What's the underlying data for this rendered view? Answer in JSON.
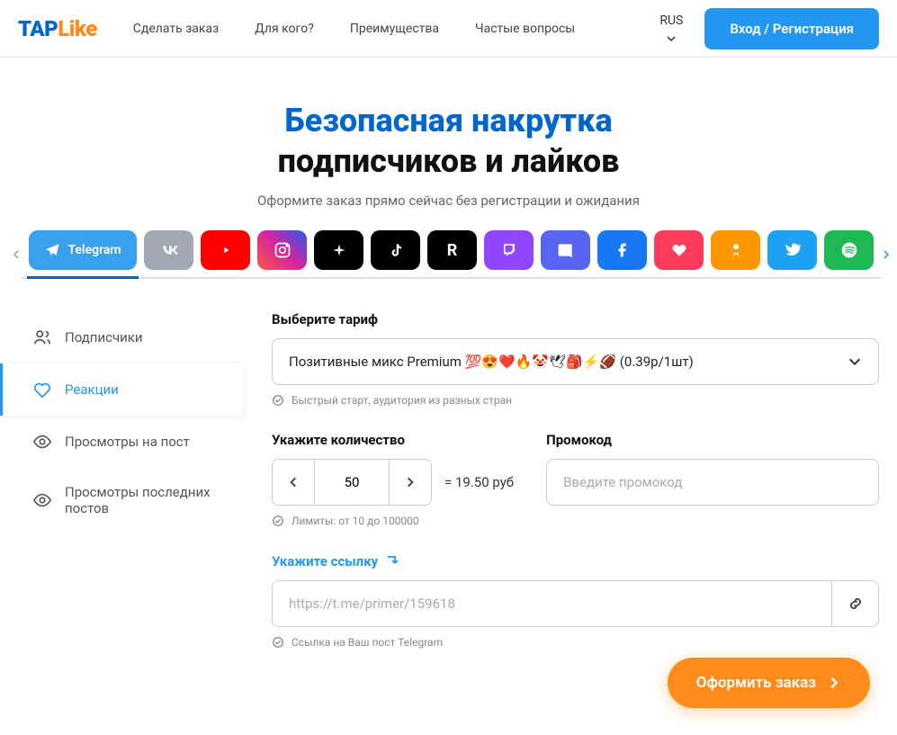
{
  "logo": {
    "part1": "TAP",
    "part2": "Like"
  },
  "nav": {
    "items": [
      "Сделать заказ",
      "Для кого?",
      "Преимущества",
      "Частые вопросы"
    ]
  },
  "lang": {
    "label": "RUS"
  },
  "login": {
    "label": "Вход / Регистрация"
  },
  "hero": {
    "line1": "Безопасная накрутка",
    "line2": "подписчиков и лайков",
    "sub": "Оформите заказ прямо сейчас без регистрации и ожидания"
  },
  "socials": {
    "active": {
      "name": "Telegram",
      "bg": "#39a0ed"
    },
    "items": [
      {
        "id": "vk",
        "bg": "#a2a9b3"
      },
      {
        "id": "youtube",
        "bg": "#ff0000"
      },
      {
        "id": "instagram",
        "bg": "linear-gradient(45deg,#fd5949,#d6249f,#285AEB)"
      },
      {
        "id": "tiktok-x",
        "bg": "#000"
      },
      {
        "id": "tiktok",
        "bg": "#000"
      },
      {
        "id": "rutube",
        "bg": "#000"
      },
      {
        "id": "twitch",
        "bg": "#9146ff"
      },
      {
        "id": "discord",
        "bg": "#5865f2"
      },
      {
        "id": "facebook",
        "bg": "#1877f2"
      },
      {
        "id": "likee",
        "bg": "#ff3b5c"
      },
      {
        "id": "ok",
        "bg": "#ff9800"
      },
      {
        "id": "twitter",
        "bg": "#1da1f2"
      },
      {
        "id": "spotify",
        "bg": "#1db954"
      }
    ]
  },
  "sidebar": {
    "items": [
      {
        "label": "Подписчики"
      },
      {
        "label": "Реакции"
      },
      {
        "label": "Просмотры на пост"
      },
      {
        "label": "Просмотры последних постов"
      }
    ]
  },
  "form": {
    "tariff_label": "Выберите тариф",
    "tariff_value": "Позитивные микс Premium 💯😍❤️🔥🤡🕊🎒⚡🏈 (0.39р/1шт)",
    "tariff_hint": "Быстрый старт, аудитория из разных стран",
    "qty_label": "Укажите количество",
    "qty_value": "50",
    "price_text": "= 19.50 руб",
    "qty_hint": "Лимиты: от 10 до 100000",
    "promo_label": "Промокод",
    "promo_placeholder": "Введите промокод",
    "link_label": "Укажите ссылку",
    "link_placeholder": "https://t.me/primer/159618",
    "link_hint": "Ссылка на Ваш пост Telegram"
  },
  "submit": {
    "label": "Оформить заказ"
  }
}
